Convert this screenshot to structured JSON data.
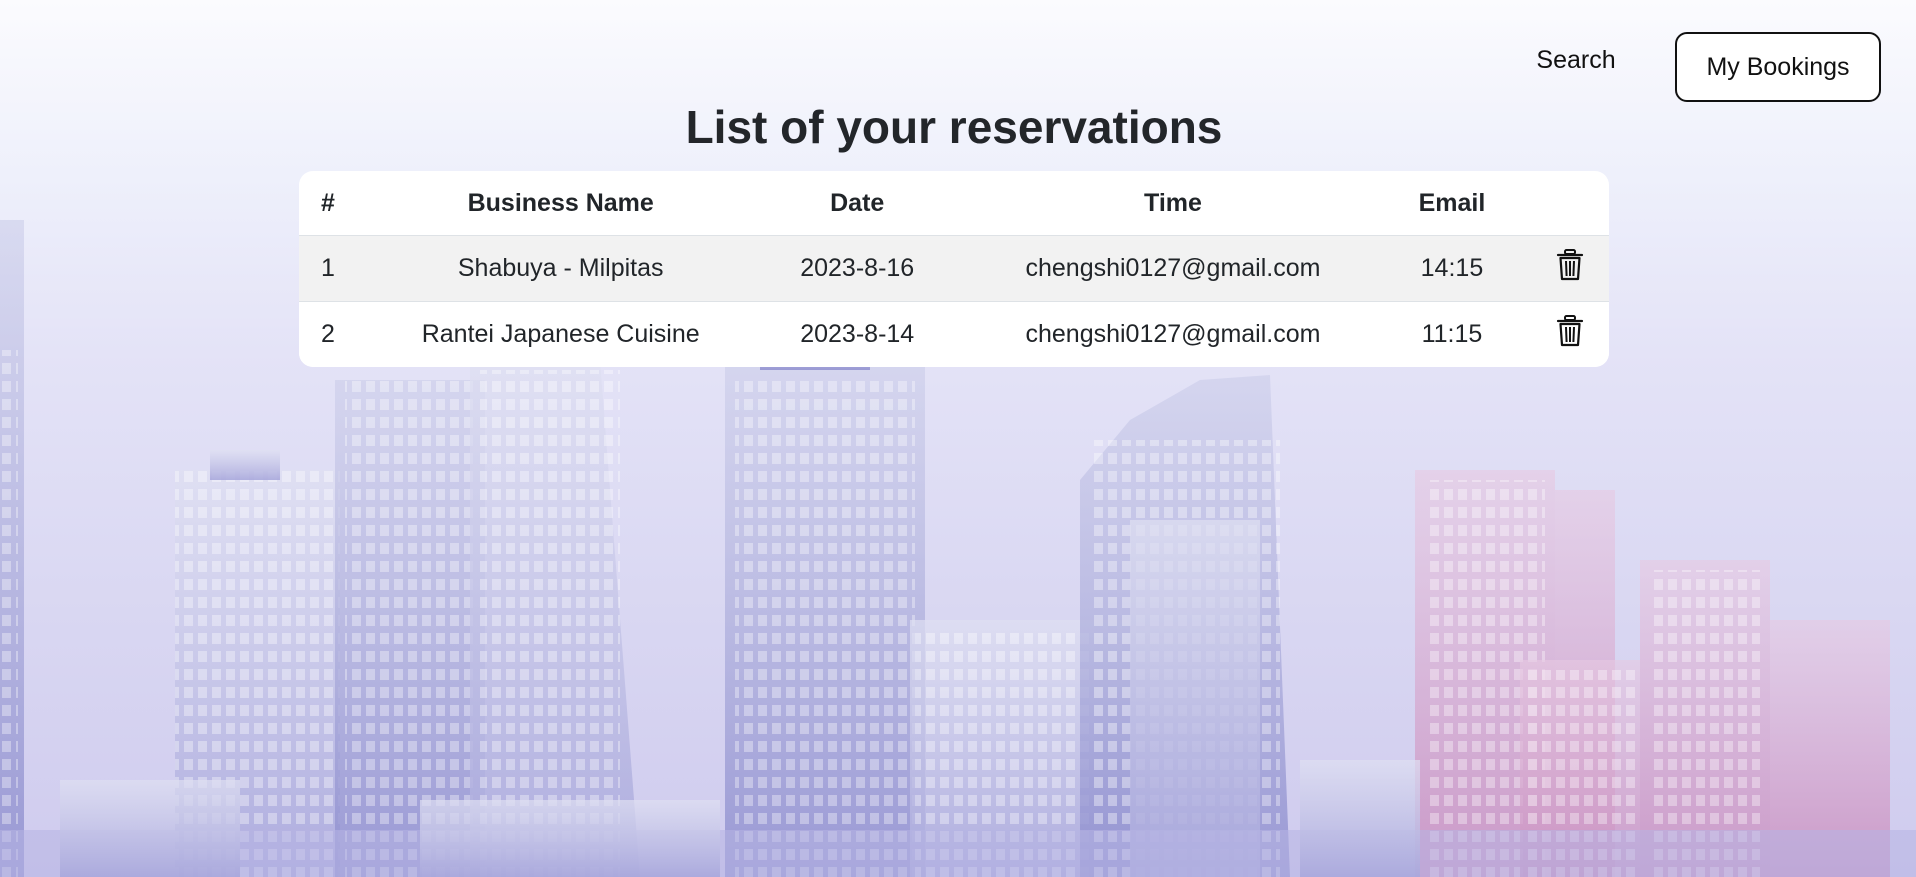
{
  "nav": {
    "search_label": "Search",
    "bookings_label": "My Bookings"
  },
  "page": {
    "title": "List of your reservations"
  },
  "table": {
    "headers": [
      "#",
      "Business Name",
      "Date",
      "Time",
      "Email"
    ],
    "rows": [
      {
        "num": "1",
        "business": "Shabuya - Milpitas",
        "date": "2023-8-16",
        "time_col": "chengshi0127@gmail.com",
        "email_col": "14:15",
        "action_icon": "trash-icon"
      },
      {
        "num": "2",
        "business": "Rantei Japanese Cuisine",
        "date": "2023-8-14",
        "time_col": "chengshi0127@gmail.com",
        "email_col": "11:15",
        "action_icon": "trash-icon"
      }
    ]
  },
  "colors": {
    "text": "#212529",
    "row_stripe": "#f2f2f2",
    "card_bg": "#ffffff",
    "bg_top": "#fbfbfe",
    "bg_bottom": "#cfcbee",
    "accent_pink": "#d9a3cf"
  }
}
